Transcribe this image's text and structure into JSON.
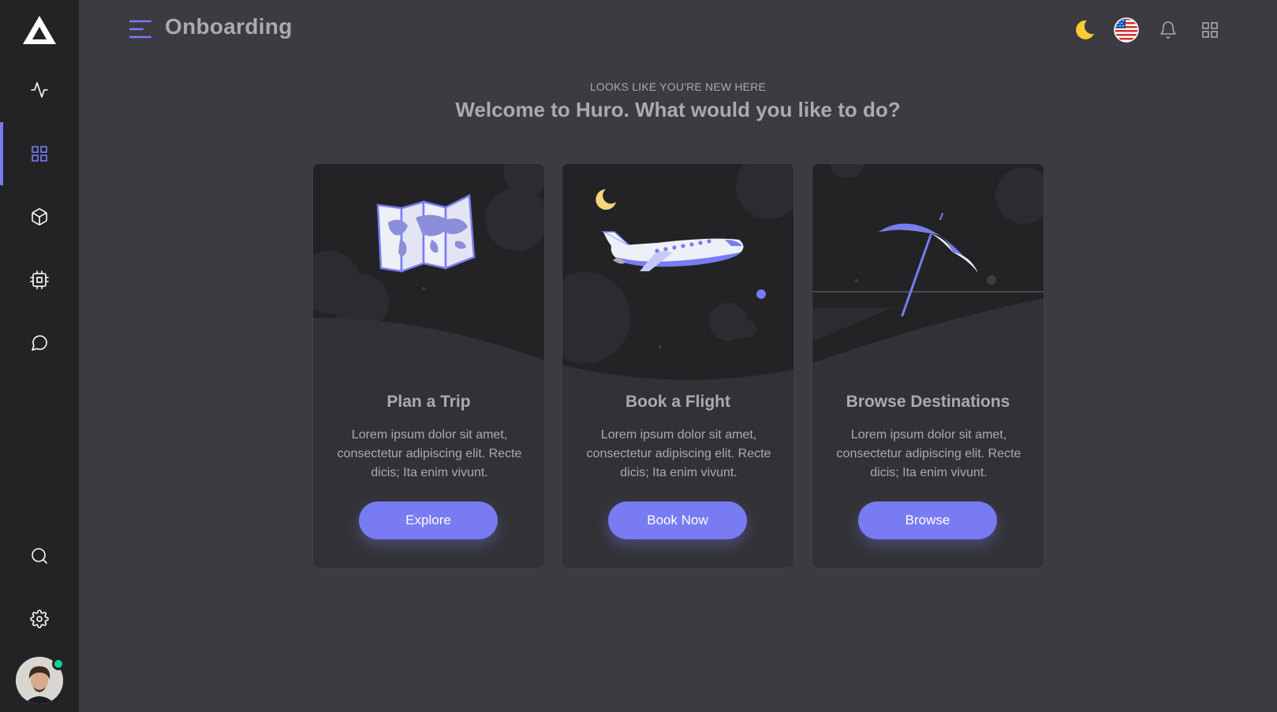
{
  "header": {
    "title": "Onboarding"
  },
  "intro": {
    "eyebrow": "LOOKS LIKE YOU'RE NEW HERE",
    "heading": "Welcome to Huro. What would you like to do?"
  },
  "cards": [
    {
      "title": "Plan a Trip",
      "text": "Lorem ipsum dolor sit amet, consectetur adipiscing elit. Recte dicis; Ita enim vivunt.",
      "button": "Explore",
      "illustration": "folded-world-map"
    },
    {
      "title": "Book a Flight",
      "text": "Lorem ipsum dolor sit amet, consectetur adipiscing elit. Recte dicis; Ita enim vivunt.",
      "button": "Book Now",
      "illustration": "airplane-at-night"
    },
    {
      "title": "Browse Destinations",
      "text": "Lorem ipsum dolor sit amet, consectetur adipiscing elit. Recte dicis; Ita enim vivunt.",
      "button": "Browse",
      "illustration": "beach-umbrella"
    }
  ],
  "sidebar": {
    "items": [
      {
        "icon": "activity-icon",
        "active": false
      },
      {
        "icon": "grid-icon",
        "active": true
      },
      {
        "icon": "box-icon",
        "active": false
      },
      {
        "icon": "cpu-icon",
        "active": false
      },
      {
        "icon": "message-circle-icon",
        "active": false
      }
    ],
    "bottom": [
      {
        "icon": "search-icon"
      },
      {
        "icon": "settings-icon"
      }
    ],
    "user_status": "online"
  },
  "toolbar": {
    "icons": [
      "dark-mode-moon-icon",
      "us-flag-language-icon",
      "notification-bell-icon",
      "apps-grid-icon"
    ]
  },
  "colors": {
    "accent": "#797bf2",
    "sidebar": "#232326",
    "background": "#3b3b41",
    "card": "#323236",
    "moon": "#fdcb32",
    "online": "#06d6a0"
  }
}
